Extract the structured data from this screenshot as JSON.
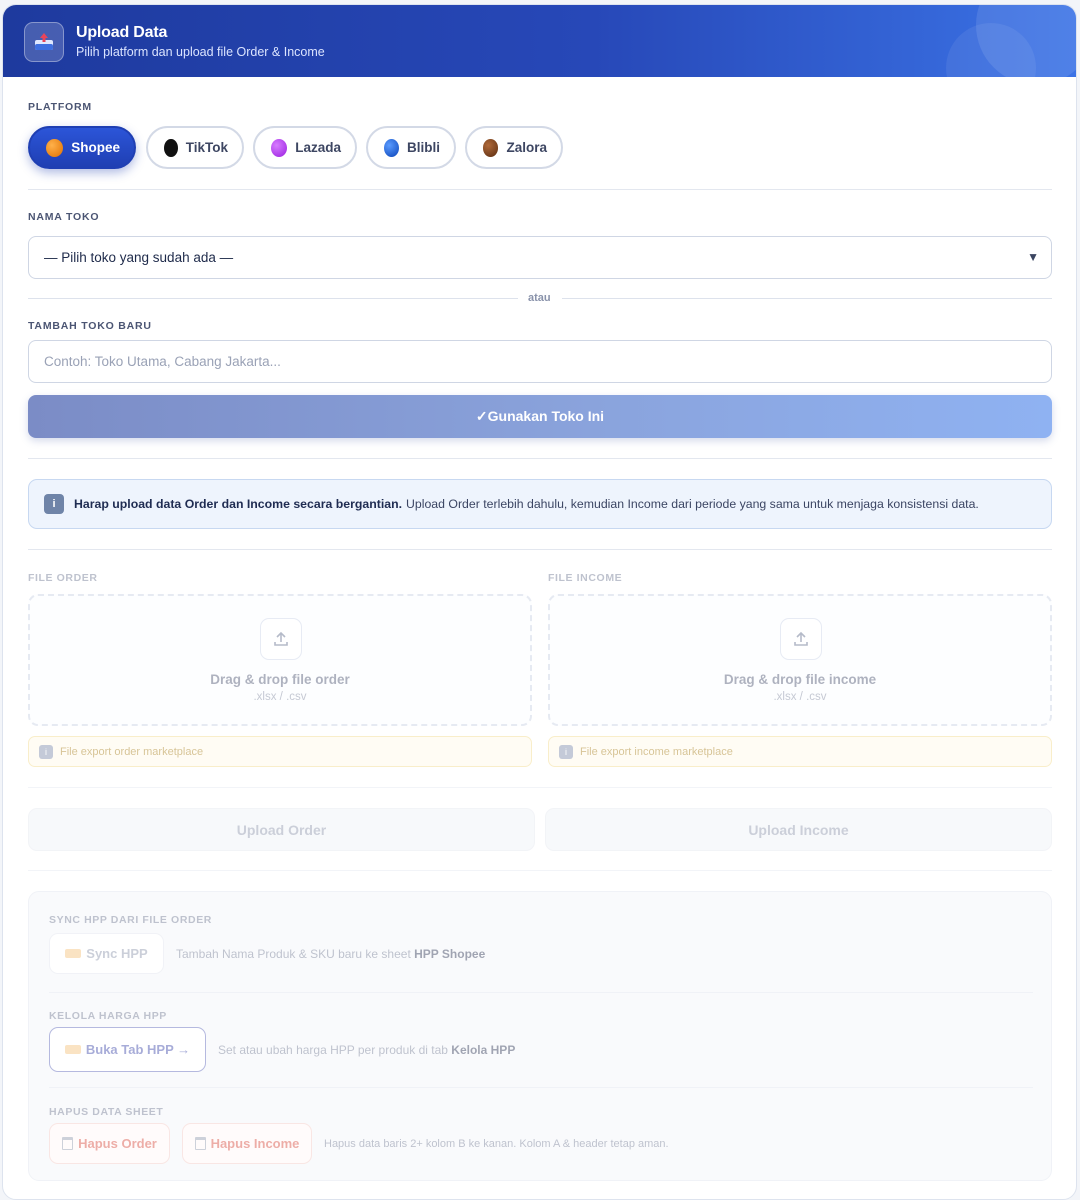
{
  "header": {
    "title": "Upload Data",
    "subtitle": "Pilih platform dan upload file Order & Income"
  },
  "platform": {
    "label": "PLATFORM",
    "items": [
      {
        "label": "Shopee",
        "color": "#f28a1a",
        "active": true
      },
      {
        "label": "TikTok",
        "color": "#111111",
        "active": false
      },
      {
        "label": "Lazada",
        "color": "#a83ae8",
        "active": false
      },
      {
        "label": "Blibli",
        "color": "#1f5fd6",
        "active": false
      },
      {
        "label": "Zalora",
        "color": "#7a4321",
        "active": false
      }
    ]
  },
  "nama_toko": {
    "label": "NAMA TOKO",
    "selected": "— Pilih toko yang sudah ada —"
  },
  "separator": "atau",
  "tambah_toko": {
    "label": "TAMBAH TOKO BARU",
    "placeholder": "Contoh: Toko Utama, Cabang Jakarta...",
    "value": ""
  },
  "use_button": "✓Gunakan Toko Ini",
  "info": {
    "bold": "Harap upload data Order dan Income secara bergantian.",
    "text": "Upload Order terlebih dahulu, kemudian Income dari periode yang sama untuk menjaga konsistensi data."
  },
  "file_order": {
    "label": "FILE ORDER",
    "drop_title": "Drag & drop file order",
    "drop_formats": ".xlsx / .csv",
    "hint": "File export order marketplace"
  },
  "file_income": {
    "label": "FILE INCOME",
    "drop_title": "Drag & drop file income",
    "drop_formats": ".xlsx / .csv",
    "hint": "File export income marketplace"
  },
  "upload_order_button": "Upload Order",
  "upload_income_button": "Upload Income",
  "tools": {
    "sync": {
      "label": "SYNC HPP DARI FILE ORDER",
      "button": "Sync HPP",
      "desc": "Tambah Nama Produk & SKU baru ke sheet",
      "desc_bold": "HPP Shopee"
    },
    "kelola": {
      "label": "KELOLA HARGA HPP",
      "button": "Buka Tab HPP →",
      "desc": "Set atau ubah harga HPP per produk di tab",
      "desc_bold": "Kelola HPP"
    },
    "hapus": {
      "label": "HAPUS DATA SHEET",
      "button_order": "Hapus Order",
      "button_income": "Hapus Income",
      "desc": "Hapus data baris 2+ kolom B ke kanan. Kolom A & header tetap aman."
    }
  }
}
